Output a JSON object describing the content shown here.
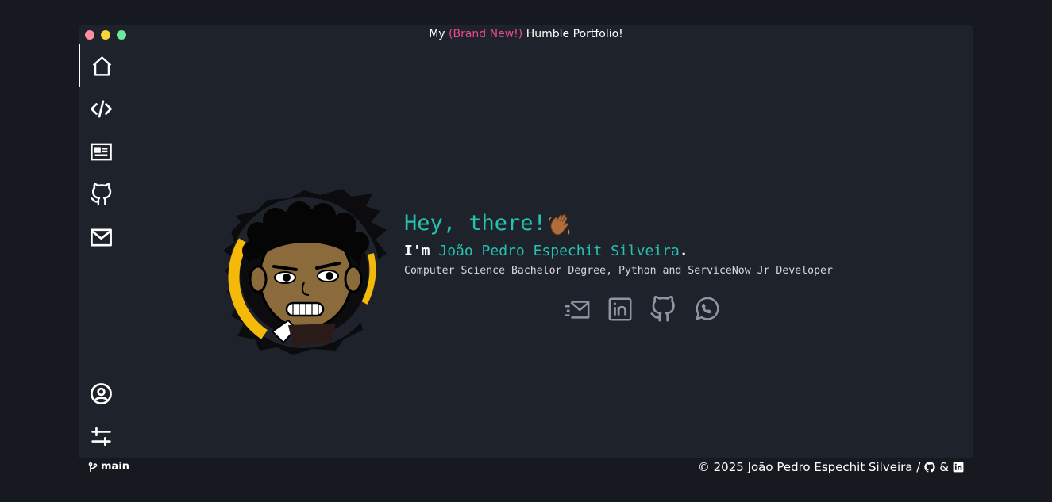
{
  "window": {
    "title_prefix": "My ",
    "title_accent": "(Brand New!)",
    "title_suffix": " Humble Portfolio!",
    "accent_color": "#ec4a8f"
  },
  "sidebar": {
    "top_items": [
      {
        "icon": "home-icon",
        "active": true
      },
      {
        "icon": "code-icon",
        "active": false
      },
      {
        "icon": "newspaper-icon",
        "active": false
      },
      {
        "icon": "github-icon",
        "active": false
      },
      {
        "icon": "mail-icon",
        "active": false
      }
    ],
    "bottom_items": [
      {
        "icon": "user-circle-icon"
      },
      {
        "icon": "sliders-icon"
      }
    ]
  },
  "hero": {
    "greeting": "Hey, there!",
    "intro_prefix": "I'm ",
    "name": "João Pedro Espechit Silveira",
    "intro_suffix": ".",
    "subtitle": "Computer Science Bachelor Degree, Python and ServiceNow Jr Developer",
    "accent_color": "#27c1b1"
  },
  "socials": [
    {
      "icon": "send-mail-icon"
    },
    {
      "icon": "linkedin-icon"
    },
    {
      "icon": "github-icon"
    },
    {
      "icon": "whatsapp-icon"
    }
  ],
  "statusbar": {
    "branch": "main",
    "copyright": "© 2025 João Pedro Espechit Silveira /",
    "ampersand": "&"
  }
}
